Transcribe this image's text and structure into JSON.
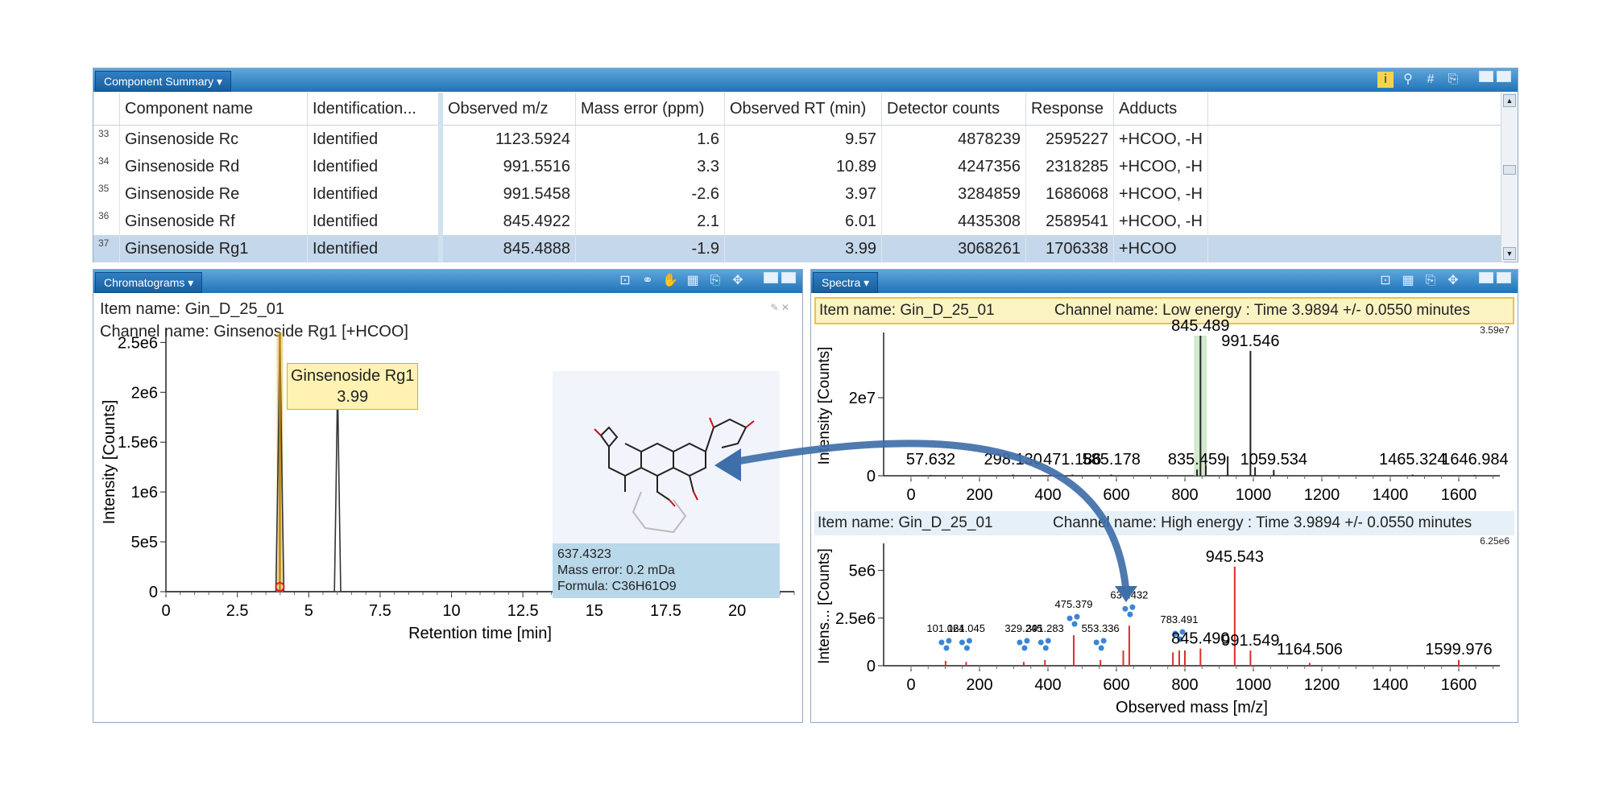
{
  "component_summary": {
    "title": "Component Summary ▾",
    "columns": [
      "Component name",
      "Identification...",
      "Observed m/z",
      "Mass error (ppm)",
      "Observed RT (min)",
      "Detector counts",
      "Response",
      "Adducts"
    ],
    "rows": [
      {
        "n": "33",
        "name": "Ginsenoside Rc",
        "id": "Identified",
        "mz": "1123.5924",
        "err": "1.6",
        "rt": "9.57",
        "counts": "4878239",
        "resp": "2595227",
        "adducts": "+HCOO, -H"
      },
      {
        "n": "34",
        "name": "Ginsenoside Rd",
        "id": "Identified",
        "mz": "991.5516",
        "err": "3.3",
        "rt": "10.89",
        "counts": "4247356",
        "resp": "2318285",
        "adducts": "+HCOO, -H"
      },
      {
        "n": "35",
        "name": "Ginsenoside Re",
        "id": "Identified",
        "mz": "991.5458",
        "err": "-2.6",
        "rt": "3.97",
        "counts": "3284859",
        "resp": "1686068",
        "adducts": "+HCOO, -H"
      },
      {
        "n": "36",
        "name": "Ginsenoside Rf",
        "id": "Identified",
        "mz": "845.4922",
        "err": "2.1",
        "rt": "6.01",
        "counts": "4435308",
        "resp": "2589541",
        "adducts": "+HCOO, -H"
      },
      {
        "n": "37",
        "name": "Ginsenoside Rg1",
        "id": "Identified",
        "mz": "845.4888",
        "err": "-1.9",
        "rt": "3.99",
        "counts": "3068261",
        "resp": "1706338",
        "adducts": "+HCOO"
      }
    ],
    "selected_row": "37"
  },
  "chromatograms": {
    "title": "Chromatograms ▾",
    "item_name": "Item name: Gin_D_25_01",
    "channel_name": "Channel name: Ginsenoside Rg1 [+HCOO]",
    "peak_label_name": "Ginsenoside Rg1",
    "peak_label_rt": "3.99",
    "structure_caption": {
      "mass": "637.4323",
      "mass_error": "Mass error: 0.2 mDa",
      "formula": "Formula: C36H61O9"
    }
  },
  "spectra": {
    "title": "Spectra ▾",
    "low": {
      "item_name": "Item name: Gin_D_25_01",
      "channel": "Channel name: Low energy : Time 3.9894 +/- 0.0550 minutes",
      "scale": "3.59e7"
    },
    "high": {
      "item_name": "Item name: Gin_D_25_01",
      "channel": "Channel name: High energy : Time 3.9894 +/- 0.0550 minutes",
      "scale": "6.25e6"
    }
  },
  "colors": {
    "titlebar": "#1f73b8",
    "selection": "#c5d7ea",
    "highlight_peak": "#b8860b",
    "high_energy": "#d9302b",
    "fragment_icon": "#3a86d6",
    "arrow": "#3f6fa8"
  },
  "chart_data": [
    {
      "type": "line",
      "name": "chromatogram",
      "xlabel": "Retention time [min]",
      "ylabel": "Intensity [Counts]",
      "xlim": [
        0,
        22
      ],
      "ylim": [
        0,
        2600000
      ],
      "xticks": [
        0,
        2.5,
        5,
        7.5,
        10,
        12.5,
        15,
        17.5,
        20
      ],
      "xtick_labels": [
        "0",
        "2.5",
        "5",
        "7.5",
        "10",
        "12.5",
        "15",
        "17.5",
        "20"
      ],
      "yticks": [
        0,
        500000,
        1000000,
        1500000,
        2000000,
        2500000
      ],
      "ytick_labels": [
        "0",
        "5e5",
        "1e6",
        "1.5e6",
        "2e6",
        "2.5e6"
      ],
      "series": [
        {
          "x": [
            0,
            3.85,
            3.92,
            3.99,
            4.06,
            4.13,
            5.9,
            5.96,
            6.01,
            6.06,
            6.12,
            22
          ],
          "y": [
            0,
            0,
            1200000,
            2600000,
            1200000,
            0,
            0,
            1100000,
            2100000,
            1100000,
            0,
            0
          ]
        }
      ],
      "highlight_x": 3.99
    },
    {
      "type": "bar",
      "name": "low-energy-spectrum",
      "ylabel": "Intensity [Counts]",
      "xlim": [
        -80,
        1720
      ],
      "ylim": [
        0,
        35900000
      ],
      "xticks": [
        0,
        200,
        400,
        600,
        800,
        1000,
        1200,
        1400,
        1600
      ],
      "xtick_labels": [
        "0",
        "200",
        "400",
        "600",
        "800",
        "1000",
        "1200",
        "1400",
        "1600"
      ],
      "yticks": [
        0,
        20000000
      ],
      "ytick_labels": [
        "0",
        "2e7"
      ],
      "peaks": [
        {
          "x": 57.632,
          "y": 200000,
          "label": "57.632"
        },
        {
          "x": 298.13,
          "y": 300000,
          "label": "298.130"
        },
        {
          "x": 471.186,
          "y": 300000,
          "label": "471.186"
        },
        {
          "x": 585.178,
          "y": 300000,
          "label": "585.178"
        },
        {
          "x": 835.459,
          "y": 1600000,
          "label": "835.459"
        },
        {
          "x": 845.489,
          "y": 35900000,
          "label": "845.489"
        },
        {
          "x": 861,
          "y": 2800000,
          "label": ""
        },
        {
          "x": 925,
          "y": 5000000,
          "label": ""
        },
        {
          "x": 991.546,
          "y": 32000000,
          "label": "991.546"
        },
        {
          "x": 1005,
          "y": 2200000,
          "label": ""
        },
        {
          "x": 1059.534,
          "y": 1500000,
          "label": "1059.534"
        },
        {
          "x": 1465.324,
          "y": 300000,
          "label": "1465.324"
        },
        {
          "x": 1646.984,
          "y": 200000,
          "label": "1646.984"
        }
      ]
    },
    {
      "type": "bar",
      "name": "high-energy-spectrum",
      "xlabel": "Observed mass [m/z]",
      "ylabel": "Intens... [Counts]",
      "xlim": [
        -80,
        1720
      ],
      "ylim": [
        0,
        6250000
      ],
      "xticks": [
        0,
        200,
        400,
        600,
        800,
        1000,
        1200,
        1400,
        1600
      ],
      "xtick_labels": [
        "0",
        "200",
        "400",
        "600",
        "800",
        "1000",
        "1200",
        "1400",
        "1600"
      ],
      "yticks": [
        0,
        2500000,
        5000000
      ],
      "ytick_labels": [
        "0",
        "2.5e6",
        "5e6"
      ],
      "peaks": [
        {
          "x": 101.024,
          "y": 250000,
          "label": "101.024",
          "icon": true
        },
        {
          "x": 161.045,
          "y": 200000,
          "label": "161.045",
          "icon": true
        },
        {
          "x": 329.245,
          "y": 200000,
          "label": "329.245",
          "icon": true
        },
        {
          "x": 391.283,
          "y": 300000,
          "label": "391.283",
          "icon": true
        },
        {
          "x": 475.379,
          "y": 1600000,
          "label": "475.379",
          "icon": true
        },
        {
          "x": 553.336,
          "y": 300000,
          "label": "553.336",
          "icon": true
        },
        {
          "x": 637.432,
          "y": 2100000,
          "label": "637.432",
          "icon": true
        },
        {
          "x": 620,
          "y": 800000,
          "label": ""
        },
        {
          "x": 765,
          "y": 700000,
          "label": ""
        },
        {
          "x": 783.491,
          "y": 800000,
          "label": "783.491",
          "icon": true
        },
        {
          "x": 800,
          "y": 800000,
          "label": ""
        },
        {
          "x": 845.49,
          "y": 900000,
          "label": "845.490"
        },
        {
          "x": 945.543,
          "y": 5200000,
          "label": "945.543"
        },
        {
          "x": 991.549,
          "y": 800000,
          "label": "991.549"
        },
        {
          "x": 1164.506,
          "y": 150000,
          "label": "1164.506"
        },
        {
          "x": 1599.976,
          "y": 300000,
          "label": "1599.976"
        }
      ]
    }
  ]
}
